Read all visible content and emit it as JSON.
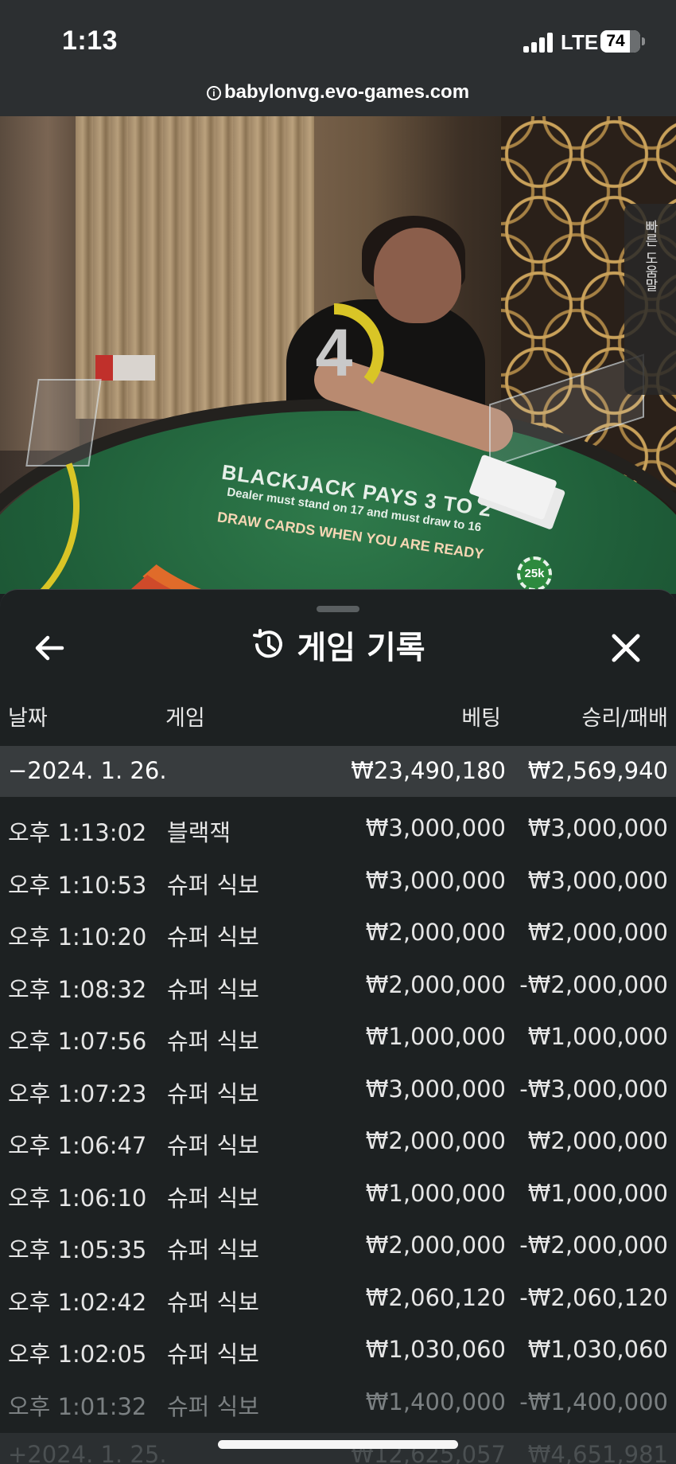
{
  "status_bar": {
    "time": "1:13",
    "network": "LTE",
    "battery": "74",
    "battery_level": 0.74
  },
  "browser": {
    "url": "babylonvg.evo-games.com"
  },
  "video": {
    "countdown": "4",
    "quick_help_label": "빠른 도움말",
    "table_text_main": "BLACKJACK PAYS 3 TO 2",
    "table_text_sub": "Dealer must stand on 17 and must draw to 16",
    "table_text_draw": "DRAW CARDS WHEN YOU ARE READY",
    "chip_label": "25k"
  },
  "history": {
    "title": "게임 기록",
    "columns": {
      "date": "날짜",
      "game": "게임",
      "bet": "베팅",
      "result": "승리/패배"
    },
    "date_group": {
      "label": "−2024. 1. 26.",
      "total_bet": "₩23,490,180",
      "total_result": "₩2,569,940"
    },
    "rows": [
      {
        "time": "오후 1:13:02",
        "game": "블랙잭",
        "bet": "₩3,000,000",
        "result": "₩3,000,000"
      },
      {
        "time": "오후 1:10:53",
        "game": "슈퍼 식보",
        "bet": "₩3,000,000",
        "result": "₩3,000,000"
      },
      {
        "time": "오후 1:10:20",
        "game": "슈퍼 식보",
        "bet": "₩2,000,000",
        "result": "₩2,000,000"
      },
      {
        "time": "오후 1:08:32",
        "game": "슈퍼 식보",
        "bet": "₩2,000,000",
        "result": "-₩2,000,000"
      },
      {
        "time": "오후 1:07:56",
        "game": "슈퍼 식보",
        "bet": "₩1,000,000",
        "result": "₩1,000,000"
      },
      {
        "time": "오후 1:07:23",
        "game": "슈퍼 식보",
        "bet": "₩3,000,000",
        "result": "-₩3,000,000"
      },
      {
        "time": "오후 1:06:47",
        "game": "슈퍼 식보",
        "bet": "₩2,000,000",
        "result": "₩2,000,000"
      },
      {
        "time": "오후 1:06:10",
        "game": "슈퍼 식보",
        "bet": "₩1,000,000",
        "result": "₩1,000,000"
      },
      {
        "time": "오후 1:05:35",
        "game": "슈퍼 식보",
        "bet": "₩2,000,000",
        "result": "-₩2,000,000"
      },
      {
        "time": "오후 1:02:42",
        "game": "슈퍼 식보",
        "bet": "₩2,060,120",
        "result": "-₩2,060,120"
      },
      {
        "time": "오후 1:02:05",
        "game": "슈퍼 식보",
        "bet": "₩1,030,060",
        "result": "₩1,030,060"
      },
      {
        "time": "오후 1:01:32",
        "game": "슈퍼 식보",
        "bet": "₩1,400,000",
        "result": "-₩1,400,000"
      }
    ],
    "next_group": {
      "label": "+2024. 1. 25.",
      "total_bet": "₩12,625,057",
      "total_result": "₩4,651,981"
    }
  },
  "colors": {
    "panel_bg": "#1d2122",
    "date_row_bg": "#383c3e",
    "timer_arc": "#d9c526",
    "table_felt": "#1f5e39"
  },
  "icons": {
    "back": "arrow-left-icon",
    "history": "history-clock-icon",
    "close": "close-icon"
  }
}
